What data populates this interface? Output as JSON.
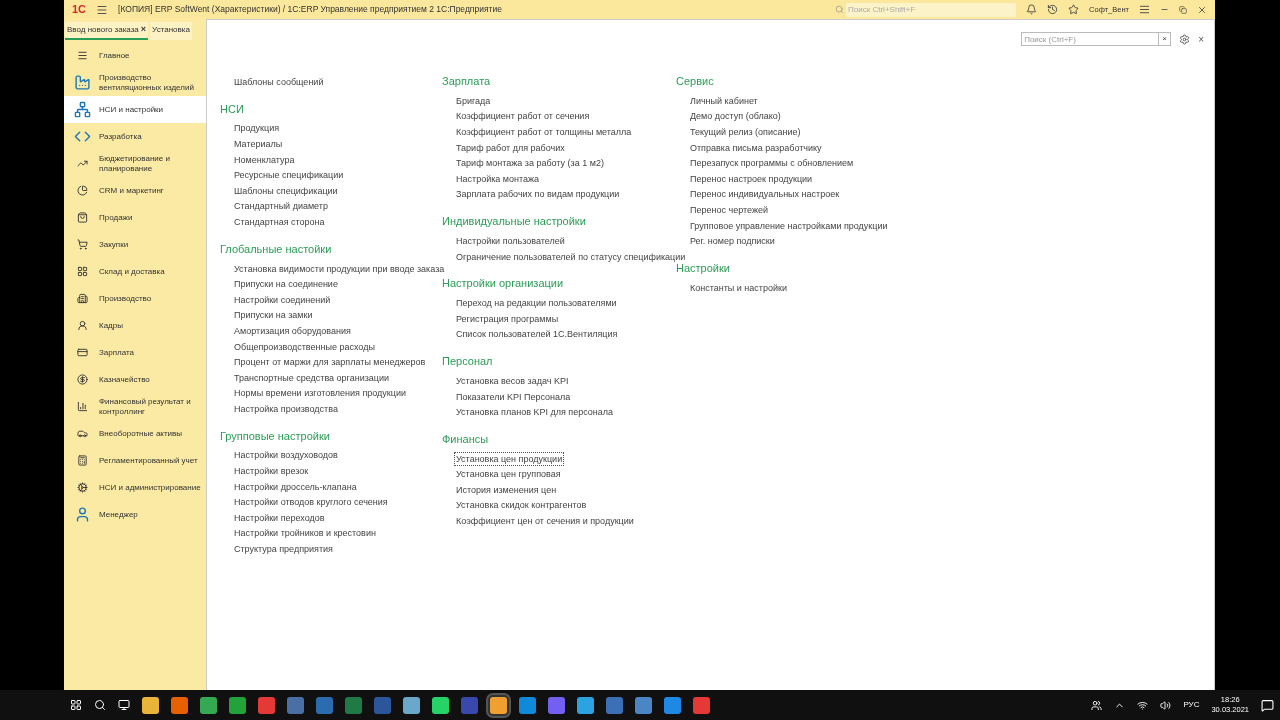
{
  "title_bar": {
    "logo": "1С",
    "title": "[КОПИЯ] ERP SoftWent (Характеристики) / 1С:ERP Управление предприятием 2 1С:Предприятие",
    "search": {
      "placeholder": "Поиск Ctrl+Shift+F"
    },
    "user": "Софт_Вент"
  },
  "tabs": [
    {
      "label": "Ввод нового заказа",
      "selected": true,
      "close": "×"
    },
    {
      "label": "Установка",
      "selected": false
    }
  ],
  "sidebar": {
    "items": [
      {
        "label": "Главное",
        "selected": false
      },
      {
        "label": "Производство вентиляционных изделий",
        "selected": false
      },
      {
        "label": "НСИ и настройки",
        "selected": true
      },
      {
        "label": "Разработка",
        "selected": false
      },
      {
        "label": "Бюджетирование и планирование",
        "selected": false
      },
      {
        "label": "CRM и маркетинг",
        "selected": false
      },
      {
        "label": "Продажи",
        "selected": false
      },
      {
        "label": "Закупки",
        "selected": false
      },
      {
        "label": "Склад и доставка",
        "selected": false
      },
      {
        "label": "Производство",
        "selected": false
      },
      {
        "label": "Кадры",
        "selected": false
      },
      {
        "label": "Зарплата",
        "selected": false
      },
      {
        "label": "Казначейство",
        "selected": false
      },
      {
        "label": "Финансовый результат и контроллинг",
        "selected": false
      },
      {
        "label": "Внеоборотные активы",
        "selected": false
      },
      {
        "label": "Регламентированный учет",
        "selected": false
      },
      {
        "label": "НСИ и администрирование",
        "selected": false
      },
      {
        "label": "Менеджер",
        "selected": false
      }
    ]
  },
  "panel": {
    "search": {
      "placeholder": "Поиск (Ctrl+F)",
      "clear": "×"
    },
    "close": "×",
    "columns": [
      [
        {
          "items": [
            {
              "label": "Шаблоны сообщений",
              "selected": false
            }
          ]
        },
        {
          "title": "НСИ",
          "items": [
            {
              "label": "Продукция",
              "selected": false
            },
            {
              "label": "Материалы",
              "selected": false
            },
            {
              "label": "Номенклатура",
              "selected": false
            },
            {
              "label": "Ресурсные спецификации",
              "selected": false
            },
            {
              "label": "Шаблоны спецификации",
              "selected": false
            },
            {
              "label": "Стандартный диаметр",
              "selected": false
            },
            {
              "label": "Стандартная сторона",
              "selected": false
            }
          ]
        },
        {
          "title": "Глобальные настойки",
          "items": [
            {
              "label": "Установка видимости продукции при вводе заказа",
              "selected": false
            },
            {
              "label": "Припуски на соединение",
              "selected": false
            },
            {
              "label": "Настройки соединений",
              "selected": false
            },
            {
              "label": "Припуски на замки",
              "selected": false
            },
            {
              "label": "Амортизация оборудования",
              "selected": false
            },
            {
              "label": "Общепроизводственные расходы",
              "selected": false
            },
            {
              "label": "Процент от маржи для зарплаты менеджеров",
              "selected": false
            },
            {
              "label": "Транспортные средства организации",
              "selected": false
            },
            {
              "label": "Нормы времени изготовления продукции",
              "selected": false
            },
            {
              "label": "Настройка производства",
              "selected": false
            }
          ]
        },
        {
          "title": "Групповые настройки",
          "items": [
            {
              "label": "Настройки воздуховодов",
              "selected": false
            },
            {
              "label": "Настройки врезок",
              "selected": false
            },
            {
              "label": "Настройки дроссель-клапана",
              "selected": false
            },
            {
              "label": "Настройки отводов круглого сечения",
              "selected": false
            },
            {
              "label": "Настройки переходов",
              "selected": false
            },
            {
              "label": "Настройки тройников и крестовин",
              "selected": false
            },
            {
              "label": "Структура предприятия",
              "selected": false
            }
          ]
        }
      ],
      [
        {
          "title": "Зарплата",
          "items": [
            {
              "label": "Бригада",
              "selected": false
            },
            {
              "label": "Коэффициент работ от сечения",
              "selected": false
            },
            {
              "label": "Коэффициент работ от толщины металла",
              "selected": false
            },
            {
              "label": "Тариф работ для рабочих",
              "selected": false
            },
            {
              "label": "Тариф монтажа за работу (за 1 м2)",
              "selected": false
            },
            {
              "label": "Настройка монтажа",
              "selected": false
            },
            {
              "label": "Зарплата рабочих по видам продукции",
              "selected": false
            }
          ]
        },
        {
          "title": "Индивидуальные настройки",
          "items": [
            {
              "label": "Настройки пользователей",
              "selected": false
            },
            {
              "label": "Ограничение пользователей по статусу спецификации",
              "selected": false
            }
          ]
        },
        {
          "title": "Настройки организации",
          "items": [
            {
              "label": "Переход на редакции пользователями",
              "selected": false
            },
            {
              "label": "Регистрация программы",
              "selected": false
            },
            {
              "label": "Список пользователей 1С.Вентиляция",
              "selected": false
            }
          ]
        },
        {
          "title": "Персонал",
          "items": [
            {
              "label": "Установка весов задач KPI",
              "selected": false
            },
            {
              "label": "Показатели KPI Персонала",
              "selected": false
            },
            {
              "label": "Установка планов KPI для персонала",
              "selected": false
            }
          ]
        },
        {
          "title": "Финансы",
          "items": [
            {
              "label": "Установка цен продукции",
              "selected": true
            },
            {
              "label": "Установка цен групповая",
              "selected": false
            },
            {
              "label": "История изменения цен",
              "selected": false
            },
            {
              "label": "Установка скидок контрагентов",
              "selected": false
            },
            {
              "label": "Коэффициент цен от сечения и продукции",
              "selected": false
            }
          ]
        }
      ],
      [
        {
          "title": "Сервис",
          "items": [
            {
              "label": "Личный кабинет",
              "selected": false
            },
            {
              "label": "Демо доступ (облако)",
              "selected": false
            },
            {
              "label": "Текущий релиз (описание)",
              "selected": false
            },
            {
              "label": "Отправка письма разработчику",
              "selected": false
            },
            {
              "label": "Перезапуск программы с обновлением",
              "selected": false
            },
            {
              "label": "Перенос настроек продукции",
              "selected": false
            },
            {
              "label": "Перенос индивидуальных настроек",
              "selected": false
            },
            {
              "label": "Перенос чертежей",
              "selected": false
            },
            {
              "label": "Групповое управление настройками продукции",
              "selected": false
            },
            {
              "label": "Рег. номер подписки",
              "selected": false
            }
          ]
        },
        {
          "title": "Настройки",
          "items": [
            {
              "label": "Константы и настройки",
              "selected": false
            }
          ]
        }
      ]
    ]
  },
  "taskbar": {
    "apps": [
      {
        "color": "#e8b53a",
        "active": false
      },
      {
        "color": "#e66000",
        "active": false
      },
      {
        "color": "#34a853",
        "active": false
      },
      {
        "color": "#22a33a",
        "active": false
      },
      {
        "color": "#e53935",
        "active": false
      },
      {
        "color": "#4a6fa5",
        "active": false
      },
      {
        "color": "#2b6cb0",
        "active": false
      },
      {
        "color": "#1f7a45",
        "active": false
      },
      {
        "color": "#2b579a",
        "active": false
      },
      {
        "color": "#6aa7c8",
        "active": false
      },
      {
        "color": "#25d366",
        "active": false
      },
      {
        "color": "#3949ab",
        "active": false
      },
      {
        "color": "#f0a030",
        "active": true
      },
      {
        "color": "#0f8ad8",
        "active": false
      },
      {
        "color": "#7360f2",
        "active": false
      },
      {
        "color": "#2aa3e0",
        "active": false
      },
      {
        "color": "#3b6fb6",
        "active": false
      },
      {
        "color": "#4a86c5",
        "active": false
      },
      {
        "color": "#1e88e5",
        "active": false
      },
      {
        "color": "#e53935",
        "active": false
      }
    ],
    "language": "РУС",
    "time": "18:26",
    "date": "30.03.2021"
  }
}
